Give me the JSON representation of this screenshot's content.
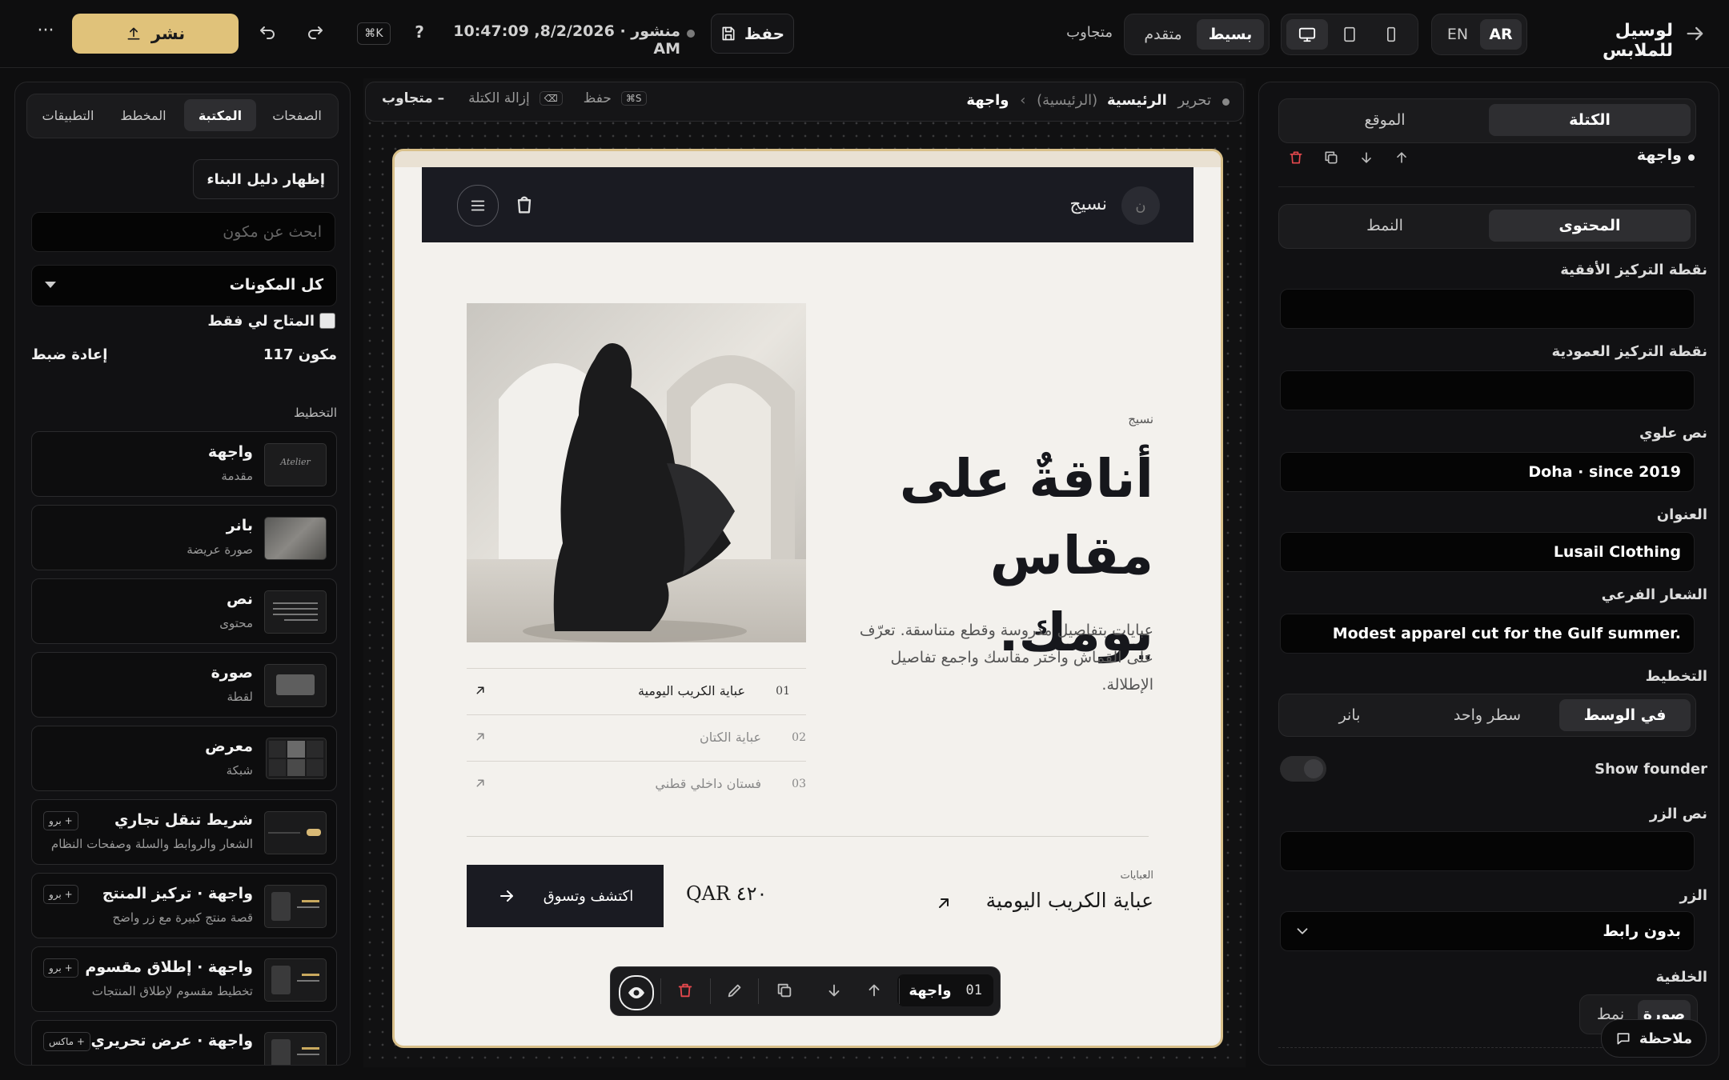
{
  "topbar": {
    "brand": "لوسيل للملابس",
    "lang_ar": "AR",
    "lang_en": "EN",
    "mode_simple": "بسيط",
    "mode_advanced": "متقدم",
    "responsive": "متجاوب",
    "save_label": "حفظ",
    "status": "منشور · 8/2/2026, 10:47:09 AM",
    "help": "?",
    "shortcut": "⌘K",
    "publish_label": "نشر",
    "more": "···"
  },
  "right_panel": {
    "tab_block": "الكتلة",
    "tab_site": "الموقع",
    "block_name": "واجهة",
    "tab_content": "المحتوى",
    "tab_style": "النمط",
    "fields": {
      "focal_x_label": "نقطة التركيز الأفقية",
      "focal_x_value": "",
      "focal_y_label": "نقطة التركيز العمودية",
      "focal_y_value": "",
      "eyebrow_label": "نص علوي",
      "eyebrow_value": "Doha · since 2019",
      "title_label": "العنوان",
      "title_value": "Lusail Clothing",
      "tagline_label": "الشعار الفرعي",
      "tagline_value": "Modest apparel cut for the Gulf summer.",
      "layout_label": "التخطيط",
      "layout_options": [
        "في الوسط",
        "سطر واحد",
        "بانر"
      ],
      "founder_label": "Show founder",
      "founder_on": false,
      "button_text_label": "نص الزر",
      "button_text_value": "",
      "button_label": "الزر",
      "button_value": "بدون رابط",
      "background_label": "الخلفية",
      "bg_image": "صورة",
      "bg_pattern": "نمط"
    },
    "feedback": "ملاحظة"
  },
  "editor_bar": {
    "edit": "تحرير",
    "home": "الرئيسية",
    "home_paren": "(الرئيسية)",
    "sep": "›",
    "current": "واجهة",
    "save_key": "⌘S",
    "save": "حفظ",
    "remove_key": "⌫",
    "remove": "إزالة الكتلة",
    "responsive": "متجاوب –"
  },
  "preview": {
    "logo_initial": "ن",
    "brand": "نسيج",
    "eyebrow": "نسيج",
    "headline_1": "أناقةٌ على",
    "headline_2": "مقاس يومك.",
    "description": "عبايات بتفاصيل مدروسة وقطع متناسقة. تعرّف على القماش واختر مقاسك واجمع تفاصيل الإطلالة.",
    "list": [
      {
        "num": "01",
        "label": "عباية الكريب اليومية"
      },
      {
        "num": "02",
        "label": "عباية الكتان"
      },
      {
        "num": "03",
        "label": "فستان داخلي قطني"
      }
    ],
    "product_category": "العبايات",
    "product_name": "عباية الكريب اليومية",
    "price": "QAR ٤٢٠",
    "cta": "اكتشف وتسوق"
  },
  "floating_toolbar": {
    "index": "01",
    "label": "واجهة"
  },
  "left_panel": {
    "tabs": [
      "الصفحات",
      "المكتبة",
      "المخطط",
      "التطبيقات"
    ],
    "guide_button": "إظهار دليل البناء",
    "search_placeholder": "ابحث عن مكون",
    "filter_value": "كل المكونات",
    "available_only": "المتاح لي فقط",
    "count": "117 مكون",
    "reset": "إعادة ضبط",
    "section_layout": "التخطيط",
    "components": [
      {
        "title": "واجهة",
        "subtitle": "مقدمة",
        "badge": ""
      },
      {
        "title": "بانر",
        "subtitle": "صورة عريضة",
        "badge": ""
      },
      {
        "title": "نص",
        "subtitle": "محتوى",
        "badge": ""
      },
      {
        "title": "صورة",
        "subtitle": "لقطة",
        "badge": ""
      },
      {
        "title": "معرض",
        "subtitle": "شبكة",
        "badge": ""
      },
      {
        "title": "شريط تنقل تجاري",
        "subtitle": "الشعار والروابط والسلة وصفحات النظام",
        "badge": "برو +"
      },
      {
        "title": "واجهة · تركيز المنتج",
        "subtitle": "قصة منتج كبيرة مع زر واضح",
        "badge": "برو +"
      },
      {
        "title": "واجهة · إطلاق مقسوم",
        "subtitle": "تخطيط مقسوم لإطلاق المنتجات",
        "badge": "برو +"
      },
      {
        "title": "واجهة · عرض تحريري",
        "subtitle": "",
        "badge": "ماكس +"
      }
    ],
    "thumb_text": "Atelier"
  },
  "colors": {
    "accent": "#e0c27a",
    "danger": "#e5484d",
    "preview_bg": "#f3f1ed",
    "preview_dark": "#1a1b22"
  }
}
